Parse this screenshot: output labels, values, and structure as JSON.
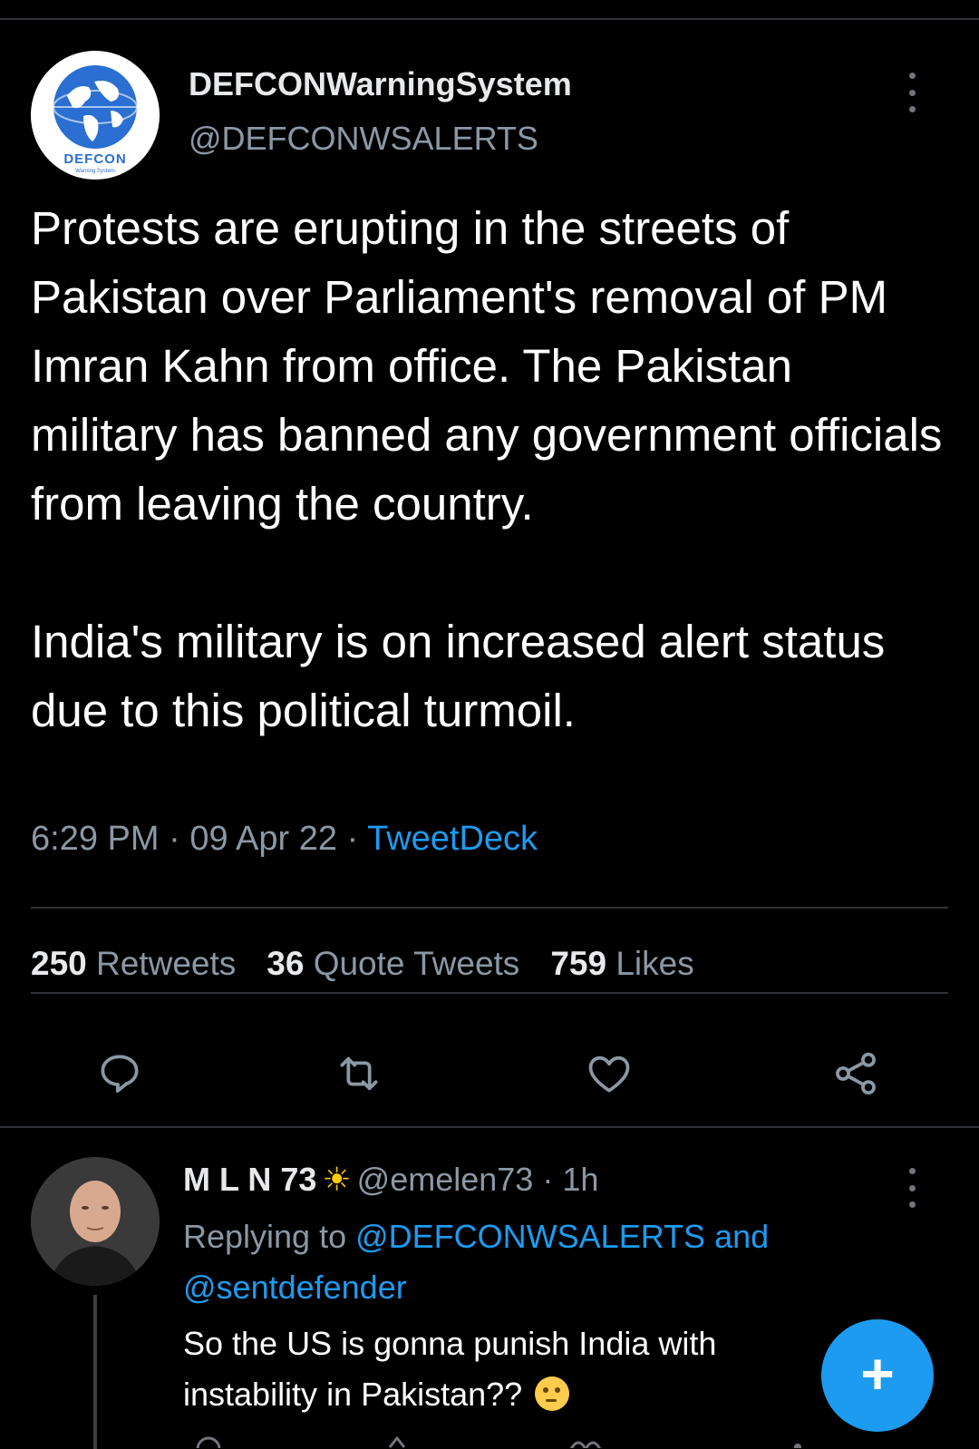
{
  "tweet": {
    "author": {
      "name": "DEFCONWarningSystem",
      "handle": "@DEFCONWSALERTS",
      "avatar_label": "DEFCON",
      "avatar_sub": "Warning System"
    },
    "text_paragraphs": [
      "Protests are erupting in the streets of Pakistan over Parliament's removal of PM Imran Kahn from office. The Pakistan military has banned any government officials from leaving the country.",
      "India's military is on increased alert status due to this political turmoil."
    ],
    "time": "6:29 PM",
    "date": "09 Apr 22",
    "separator": "·",
    "source": "TweetDeck",
    "stats": {
      "retweets": {
        "count": "250",
        "label": "Retweets"
      },
      "quotes": {
        "count": "36",
        "label": "Quote Tweets"
      },
      "likes": {
        "count": "759",
        "label": "Likes"
      }
    },
    "action_icons": [
      "reply-icon",
      "retweet-icon",
      "like-icon",
      "share-icon"
    ]
  },
  "reply": {
    "name": "M L N 73",
    "name_emoji": "☀",
    "handle": "@emelen73",
    "separator": "·",
    "age": "1h",
    "replying_prefix": "Replying to",
    "mention1": "@DEFCONWSALERTS",
    "connector": "and",
    "mention2": "@sentdefender",
    "text": "So the US is gonna punish India with instability in Pakistan??",
    "emoji": "thinking-face-icon"
  },
  "fab": {
    "label": "+"
  },
  "colors": {
    "background": "#000000",
    "text": "#e7e9ea",
    "muted": "#8b98a5",
    "accent": "#1d9bf0",
    "divider": "#2f3336"
  }
}
